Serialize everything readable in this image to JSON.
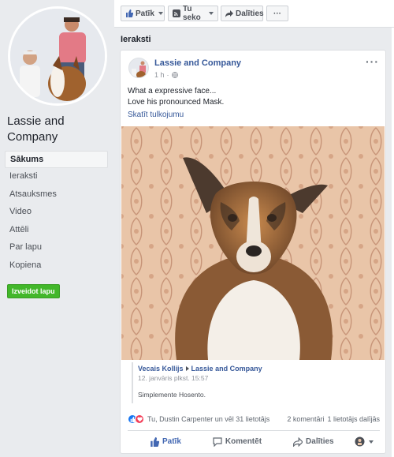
{
  "sidebar": {
    "page_name": "Lassie and Company",
    "nav": [
      {
        "label": "Sākums",
        "active": true
      },
      {
        "label": "Ieraksti",
        "active": false
      },
      {
        "label": "Atsauksmes",
        "active": false
      },
      {
        "label": "Video",
        "active": false
      },
      {
        "label": "Attēli",
        "active": false
      },
      {
        "label": "Par lapu",
        "active": false
      },
      {
        "label": "Kopiena",
        "active": false
      }
    ],
    "create_page_label": "Izveidot lapu"
  },
  "action_bar": {
    "like_label": "Patīk",
    "follow_label": "Tu seko",
    "share_label": "Dalīties",
    "more_label": "···"
  },
  "section_title": "Ieraksti",
  "post": {
    "author": "Lassie and Company",
    "time": "1 h",
    "more": "···",
    "text_line1": "What a expressive face...",
    "text_line2": "Love his pronounced Mask.",
    "see_translation": "Skatīt tulkojumu",
    "shared": {
      "from": "Vecais Kollijs",
      "to": "Lassie and Company",
      "time": "12. janvāris plkst. 15:57",
      "body": "Simplemente Hosento."
    },
    "reactions_text": "Tu, Dustin Carpenter un vēl 31 lietotājs",
    "comments": "2 komentāri",
    "shares": "1 lietotājs dalījās",
    "actions": {
      "like": "Patīk",
      "comment": "Komentēt",
      "share": "Dalīties"
    }
  },
  "colors": {
    "fb_blue": "#4267b2",
    "link_blue": "#365899",
    "green": "#42b72a"
  }
}
